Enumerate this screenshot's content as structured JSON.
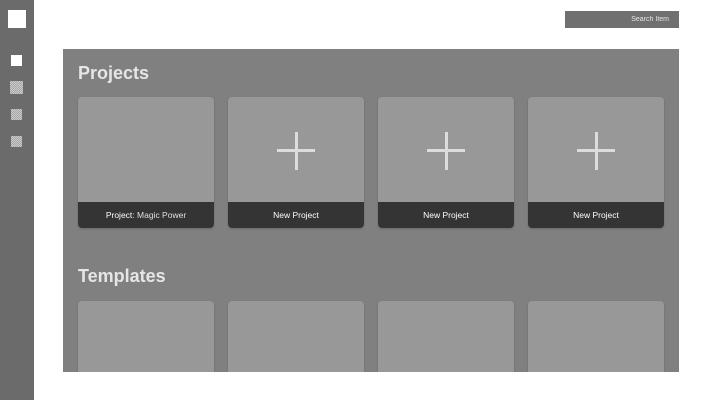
{
  "sidebar": {
    "logo": "app-logo",
    "items": [
      {
        "icon": "home-icon",
        "active": true
      },
      {
        "icon": "pattern-icon",
        "active": false
      },
      {
        "icon": "pattern-icon",
        "active": false
      },
      {
        "icon": "pattern-icon",
        "active": false
      }
    ]
  },
  "search": {
    "placeholder": "Search Item"
  },
  "projects": {
    "title": "Projects",
    "cards": [
      {
        "prefix": "Project",
        "name": ": Magic Power",
        "type": "existing"
      },
      {
        "label": "New Project",
        "type": "new"
      },
      {
        "label": "New Project",
        "type": "new"
      },
      {
        "label": "New Project",
        "type": "new"
      }
    ]
  },
  "templates": {
    "title": "Templates",
    "count": 4
  },
  "colors": {
    "sidebar": "#6b6b6b",
    "main_panel": "#808080",
    "card": "#989898",
    "card_footer": "#343434",
    "title_text": "#e6e6e6"
  }
}
